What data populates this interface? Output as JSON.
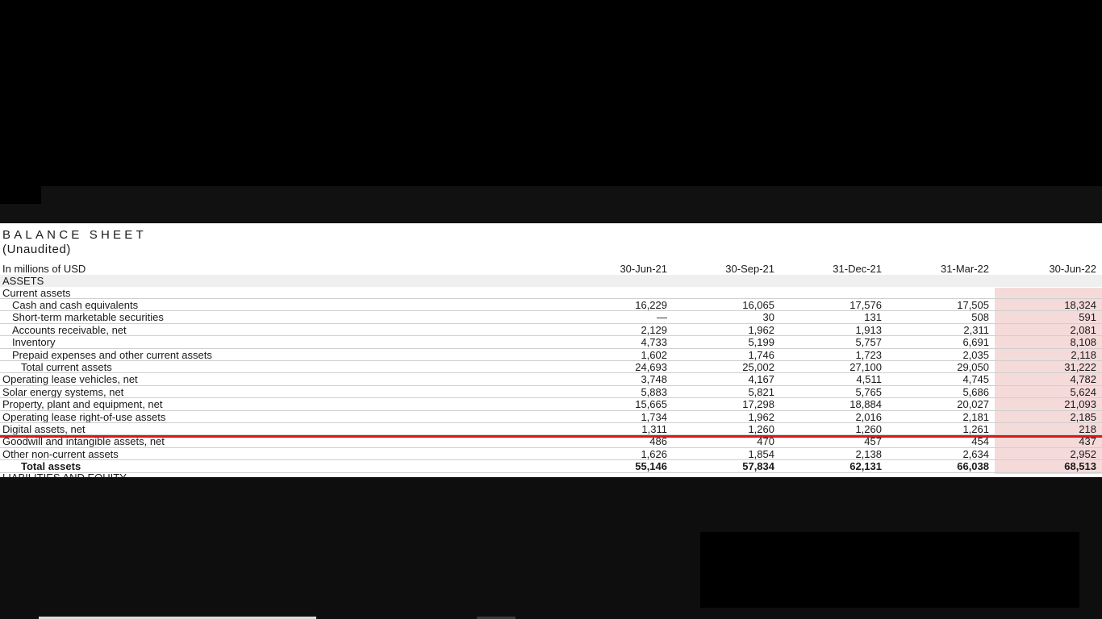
{
  "document": {
    "title": "BALANCE SHEET",
    "subtitle": "(Unaudited)",
    "units": "In millions of USD",
    "columns": [
      "30-Jun-21",
      "30-Sep-21",
      "31-Dec-21",
      "31-Mar-22",
      "30-Jun-22"
    ],
    "section_assets": "ASSETS",
    "section_current": "Current assets",
    "rows": [
      {
        "label": "Cash and cash equivalents",
        "indent": 1,
        "bold": false,
        "values": [
          "16,229",
          "16,065",
          "17,576",
          "17,505",
          "18,324"
        ]
      },
      {
        "label": "Short-term marketable securities",
        "indent": 1,
        "bold": false,
        "values": [
          "—",
          "30",
          "131",
          "508",
          "591"
        ]
      },
      {
        "label": "Accounts receivable, net",
        "indent": 1,
        "bold": false,
        "values": [
          "2,129",
          "1,962",
          "1,913",
          "2,311",
          "2,081"
        ]
      },
      {
        "label": "Inventory",
        "indent": 1,
        "bold": false,
        "values": [
          "4,733",
          "5,199",
          "5,757",
          "6,691",
          "8,108"
        ]
      },
      {
        "label": "Prepaid expenses and other current assets",
        "indent": 1,
        "bold": false,
        "values": [
          "1,602",
          "1,746",
          "1,723",
          "2,035",
          "2,118"
        ]
      },
      {
        "label": "Total current assets",
        "indent": 2,
        "bold": false,
        "values": [
          "24,693",
          "25,002",
          "27,100",
          "29,050",
          "31,222"
        ]
      },
      {
        "label": "Operating lease vehicles, net",
        "indent": 0,
        "bold": false,
        "values": [
          "3,748",
          "4,167",
          "4,511",
          "4,745",
          "4,782"
        ]
      },
      {
        "label": "Solar energy systems, net",
        "indent": 0,
        "bold": false,
        "values": [
          "5,883",
          "5,821",
          "5,765",
          "5,686",
          "5,624"
        ]
      },
      {
        "label": "Property, plant and equipment, net",
        "indent": 0,
        "bold": false,
        "values": [
          "15,665",
          "17,298",
          "18,884",
          "20,027",
          "21,093"
        ]
      },
      {
        "label": "Operating lease right-of-use assets",
        "indent": 0,
        "bold": false,
        "values": [
          "1,734",
          "1,962",
          "2,016",
          "2,181",
          "2,185"
        ]
      },
      {
        "label": "Digital assets, net",
        "indent": 0,
        "bold": false,
        "values": [
          "1,311",
          "1,260",
          "1,260",
          "1,261",
          "218"
        ]
      },
      {
        "label": "Goodwill and intangible assets, net",
        "indent": 0,
        "bold": false,
        "values": [
          "486",
          "470",
          "457",
          "454",
          "437"
        ]
      },
      {
        "label": "Other non-current assets",
        "indent": 0,
        "bold": false,
        "values": [
          "1,626",
          "1,854",
          "2,138",
          "2,634",
          "2,952"
        ]
      },
      {
        "label": "Total assets",
        "indent": 2,
        "bold": true,
        "values": [
          "55,146",
          "57,834",
          "62,131",
          "66,038",
          "68,513"
        ]
      }
    ],
    "next_section_partial": "LIABILITIES AND EQUITY"
  },
  "colors": {
    "highlight_column": "#f5dada",
    "annotation_line": "#e11414",
    "section_band": "#efefef"
  }
}
